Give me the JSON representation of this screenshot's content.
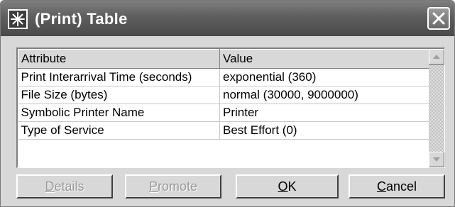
{
  "window": {
    "title": "(Print) Table",
    "icon": "app-star-icon",
    "close_icon": "close-icon"
  },
  "table": {
    "headers": [
      "Attribute",
      "Value"
    ],
    "rows": [
      {
        "attribute": "Print Interarrival Time (seconds)",
        "value": "exponential (360)"
      },
      {
        "attribute": "File Size (bytes)",
        "value": "normal (30000, 9000000)"
      },
      {
        "attribute": "Symbolic Printer Name",
        "value": "Printer"
      },
      {
        "attribute": "Type of Service",
        "value": "Best Effort (0)"
      }
    ]
  },
  "buttons": {
    "details": {
      "mnemonic": "D",
      "rest": "etails",
      "enabled": false
    },
    "promote": {
      "mnemonic": "P",
      "rest": "romote",
      "enabled": false
    },
    "ok": {
      "mnemonic": "O",
      "rest": "K",
      "enabled": true
    },
    "cancel": {
      "mnemonic": "C",
      "rest": "ancel",
      "enabled": true
    }
  }
}
